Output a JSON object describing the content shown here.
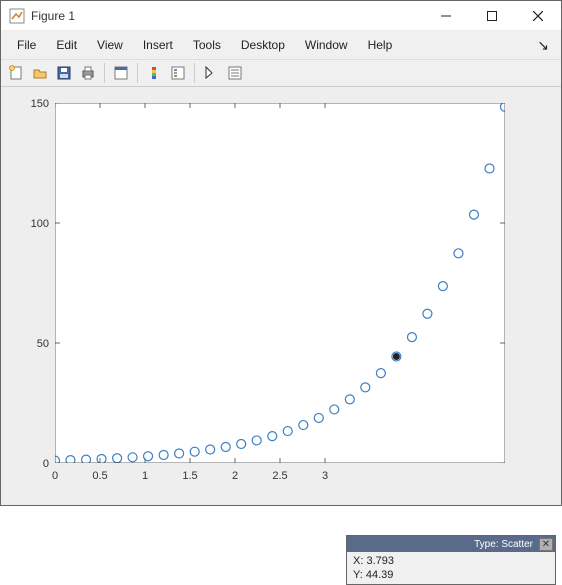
{
  "window": {
    "title": "Figure 1"
  },
  "menu": {
    "items": [
      "File",
      "Edit",
      "View",
      "Insert",
      "Tools",
      "Desktop",
      "Window",
      "Help"
    ]
  },
  "toolbar_icons": [
    "new-figure-icon",
    "open-icon",
    "save-icon",
    "print-icon",
    "|",
    "copy-figure-icon",
    "|",
    "colorbar-icon",
    "legend-icon",
    "|",
    "edit-plot-icon",
    "properties-icon"
  ],
  "chart_data": {
    "type": "scatter",
    "x": [
      0,
      0.172,
      0.345,
      0.517,
      0.69,
      0.862,
      1.034,
      1.207,
      1.379,
      1.552,
      1.724,
      1.897,
      2.069,
      2.241,
      2.414,
      2.586,
      2.759,
      2.931,
      3.103,
      3.276,
      3.448,
      3.621,
      3.793,
      3.966,
      4.138,
      4.31,
      4.483,
      4.655,
      4.828,
      5.0
    ],
    "y": [
      1.0,
      1.19,
      1.41,
      1.68,
      1.99,
      2.37,
      2.81,
      3.34,
      3.97,
      4.72,
      5.61,
      6.67,
      7.93,
      9.41,
      11.19,
      13.3,
      15.8,
      18.78,
      22.32,
      26.52,
      31.52,
      37.45,
      44.39,
      52.46,
      62.18,
      73.7,
      87.36,
      103.5,
      122.7,
      148.4
    ],
    "xlim": [
      0,
      5
    ],
    "ylim": [
      0,
      150
    ],
    "xticks": [
      0,
      0.5,
      1,
      1.5,
      2,
      2.5,
      3
    ],
    "yticks": [
      0,
      50,
      100,
      150
    ],
    "marker_color": "#3b7fc4",
    "title": "",
    "xlabel": "",
    "ylabel": "",
    "selected_point_index": 22
  },
  "datatip": {
    "type_label": "Type: Scatter",
    "x_label": "X: 3.793",
    "y_label": "Y: 44.39"
  }
}
